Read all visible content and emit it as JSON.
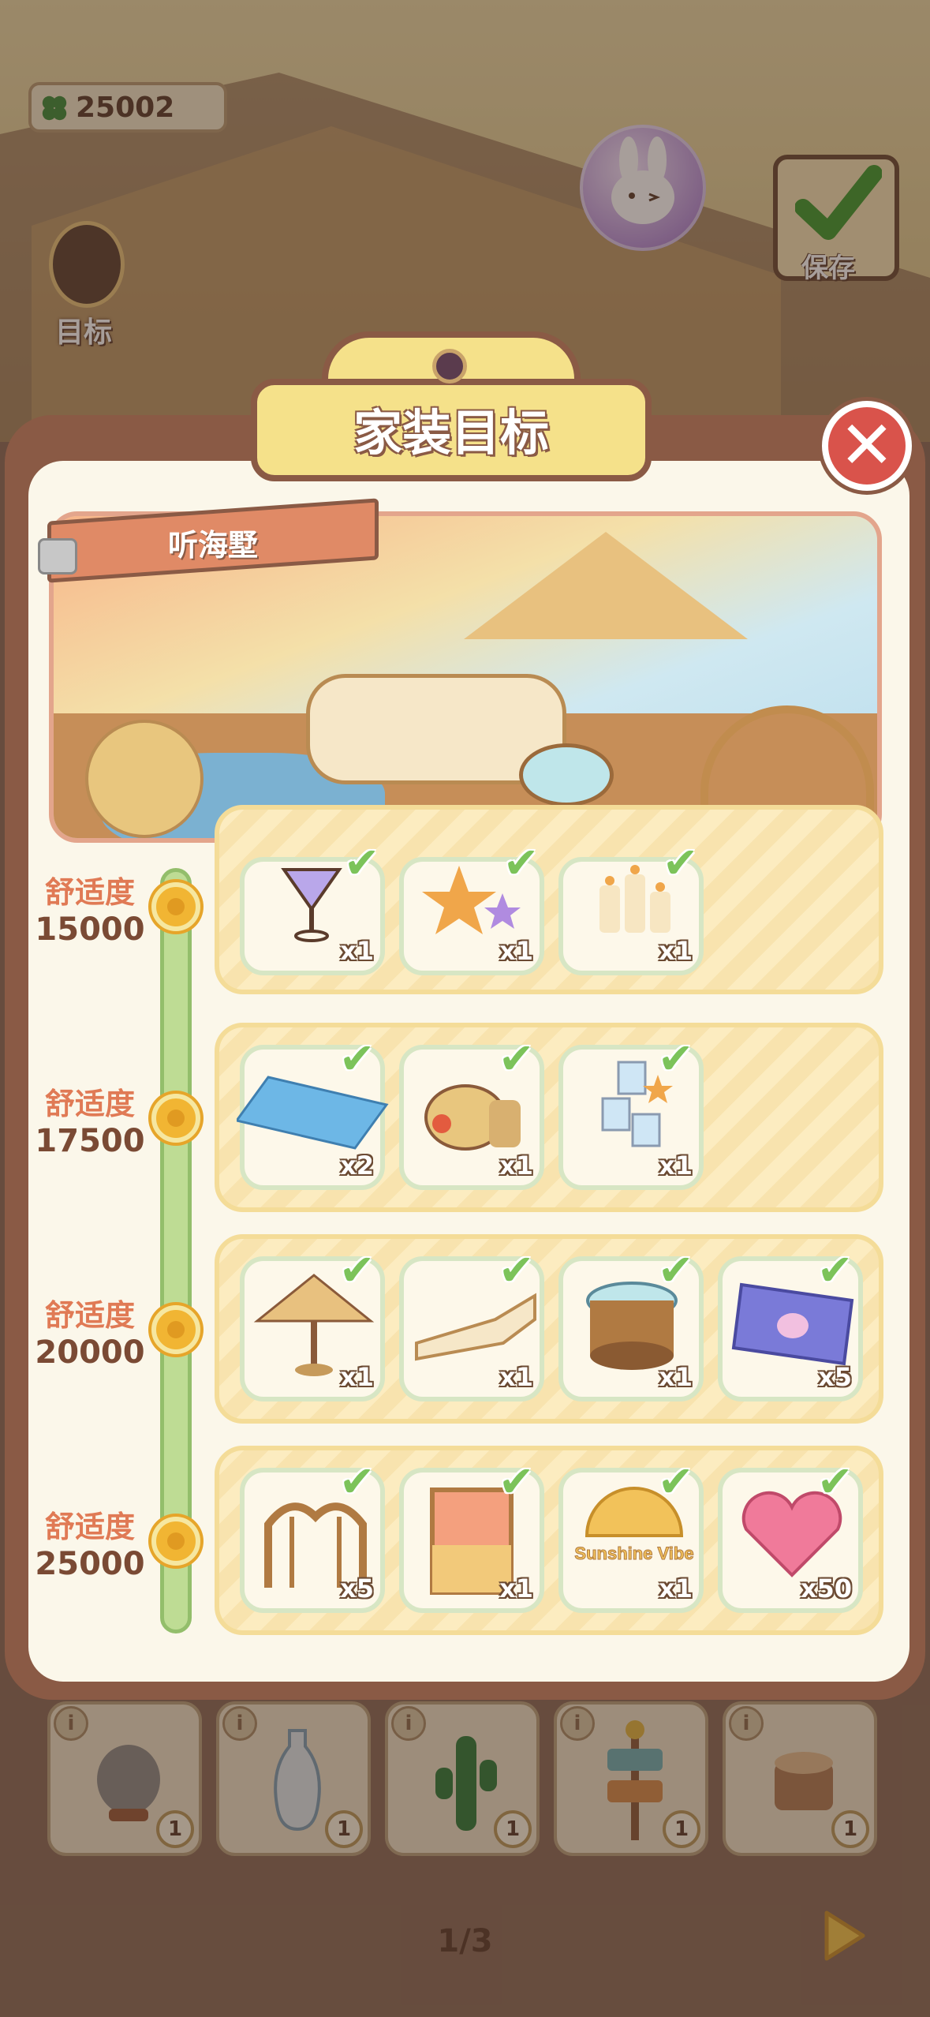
{
  "hud": {
    "currency_icon": "clover-icon",
    "currency_value": "25002",
    "goal_label": "目标",
    "save_label": "保存"
  },
  "modal": {
    "title": "家装目标",
    "close_icon": "close-icon",
    "scene_name": "听海墅"
  },
  "tiers": [
    {
      "label": "舒适度",
      "value": "15000",
      "items": [
        {
          "icon": "cocktail-icon",
          "count": "x1",
          "done": true
        },
        {
          "icon": "starfish-icon",
          "count": "x1",
          "done": true
        },
        {
          "icon": "candles-icon",
          "count": "x1",
          "done": true
        }
      ]
    },
    {
      "label": "舒适度",
      "value": "17500",
      "items": [
        {
          "icon": "water-rug-icon",
          "count": "x2",
          "done": true
        },
        {
          "icon": "straw-hat-icon",
          "count": "x1",
          "done": true
        },
        {
          "icon": "photo-board-icon",
          "count": "x1",
          "done": true
        }
      ]
    },
    {
      "label": "舒适度",
      "value": "20000",
      "items": [
        {
          "icon": "straw-umbrella-icon",
          "count": "x1",
          "done": true
        },
        {
          "icon": "lounge-chair-icon",
          "count": "x1",
          "done": true
        },
        {
          "icon": "rattan-table-icon",
          "count": "x1",
          "done": true
        },
        {
          "icon": "bunny-ticket-icon",
          "count": "x5",
          "done": true
        }
      ]
    },
    {
      "label": "舒适度",
      "value": "25000",
      "items": [
        {
          "icon": "rattan-gate-icon",
          "count": "x5",
          "done": true
        },
        {
          "icon": "sunset-window-icon",
          "count": "x1",
          "done": true
        },
        {
          "icon": "sunshine-vibe-sign-icon",
          "count": "x1",
          "done": true,
          "text": "Sunshine Vibe"
        },
        {
          "icon": "heart-gem-icon",
          "count": "x50",
          "done": true
        }
      ]
    }
  ],
  "inventory": {
    "info_glyph": "i",
    "slots": [
      {
        "icon": "rock-icon",
        "count": "1"
      },
      {
        "icon": "vase-icon",
        "count": "1"
      },
      {
        "icon": "cactus-icon",
        "count": "1"
      },
      {
        "icon": "signpost-icon",
        "count": "1"
      },
      {
        "icon": "tree-stump-icon",
        "count": "1"
      }
    ],
    "page": "1/3"
  },
  "colors": {
    "modal_border": "#8a5a45",
    "tab_yellow": "#f5e18a",
    "check_green": "#7cc35a",
    "close_red": "#d9534b",
    "tier_label": "#e07a55"
  }
}
